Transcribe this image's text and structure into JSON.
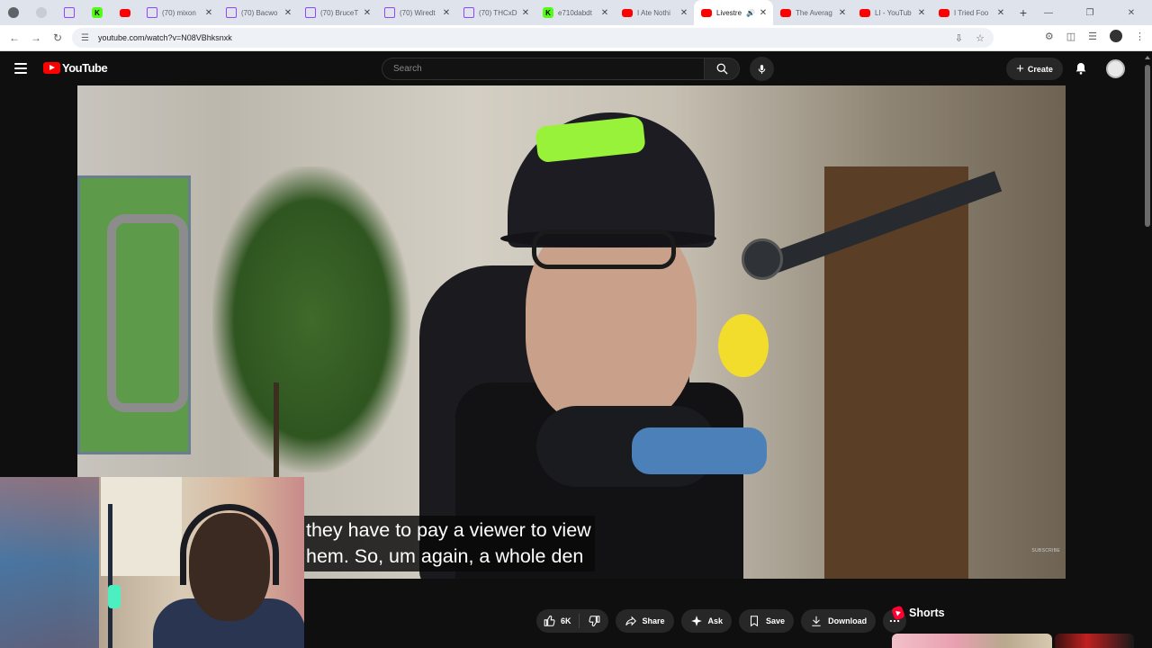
{
  "browser": {
    "tabs": [
      {
        "title": "",
        "icon": "chrome-icon",
        "pinned": true
      },
      {
        "title": "",
        "icon": "blank-icon",
        "pinned": true
      },
      {
        "title": "",
        "icon": "twitch-icon",
        "pinned": true
      },
      {
        "title": "",
        "icon": "kick-icon",
        "pinned": true
      },
      {
        "title": "",
        "icon": "youtube-icon",
        "pinned": true
      },
      {
        "title": "(70) mixon",
        "icon": "twitch-icon"
      },
      {
        "title": "(70) Bacwo",
        "icon": "twitch-icon"
      },
      {
        "title": "(70) BruceT",
        "icon": "twitch-icon"
      },
      {
        "title": "(70) Wiredt",
        "icon": "twitch-icon"
      },
      {
        "title": "(70) THCxD",
        "icon": "twitch-icon"
      },
      {
        "title": "e710dabdt",
        "icon": "kick-icon"
      },
      {
        "title": "I Ate Nothi",
        "icon": "youtube-icon"
      },
      {
        "title": "Livestre",
        "icon": "youtube-icon",
        "active": true,
        "audio": true
      },
      {
        "title": "The Averag",
        "icon": "youtube-icon"
      },
      {
        "title": "LI - YouTub",
        "icon": "youtube-icon"
      },
      {
        "title": "I Tried Foo",
        "icon": "youtube-icon"
      }
    ],
    "url": "youtube.com/watch?v=N08VBhksnxk"
  },
  "youtube": {
    "logo_text": "YouTube",
    "search_placeholder": "Search",
    "create_label": "Create"
  },
  "video": {
    "captions": [
      "they have to pay a viewer to view",
      "hem. So, um again, a whole den"
    ],
    "watermark": "SUBSCRIBE"
  },
  "actions": {
    "like_count": "6K",
    "share": "Share",
    "ask": "Ask",
    "save": "Save",
    "download": "Download"
  },
  "sidebar": {
    "shorts_title": "Shorts"
  },
  "colors": {
    "youtube_red": "#ff0000",
    "twitch_purple": "#9146ff",
    "kick_green": "#53fc18",
    "page_bg": "#0f0f0f"
  }
}
